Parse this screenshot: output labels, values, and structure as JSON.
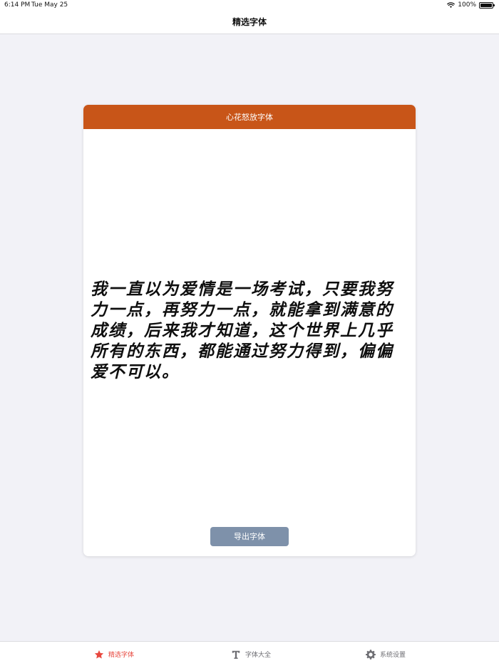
{
  "status_bar": {
    "time": "6:14 PM",
    "date": "Tue May 25",
    "battery": "100%"
  },
  "nav": {
    "title": "精选字体"
  },
  "card": {
    "title": "心花怒放字体",
    "sample_text": "我一直以为爱情是一场考试，只要我努力一点，再努力一点，就能拿到满意的成绩，后来我才知道，这个世界上几乎所有的东西，都能通过努力得到，偏偏爱不可以。",
    "export_label": "导出字体"
  },
  "tabs": [
    {
      "label": "精选字体",
      "icon": "star-icon",
      "active": true
    },
    {
      "label": "字体大全",
      "icon": "text-t-icon",
      "active": false
    },
    {
      "label": "系统设置",
      "icon": "gear-icon",
      "active": false
    }
  ],
  "colors": {
    "accent": "#e8483f",
    "card_header": "#c85518",
    "export_button": "#7e91aa",
    "background": "#f2f2f7"
  }
}
